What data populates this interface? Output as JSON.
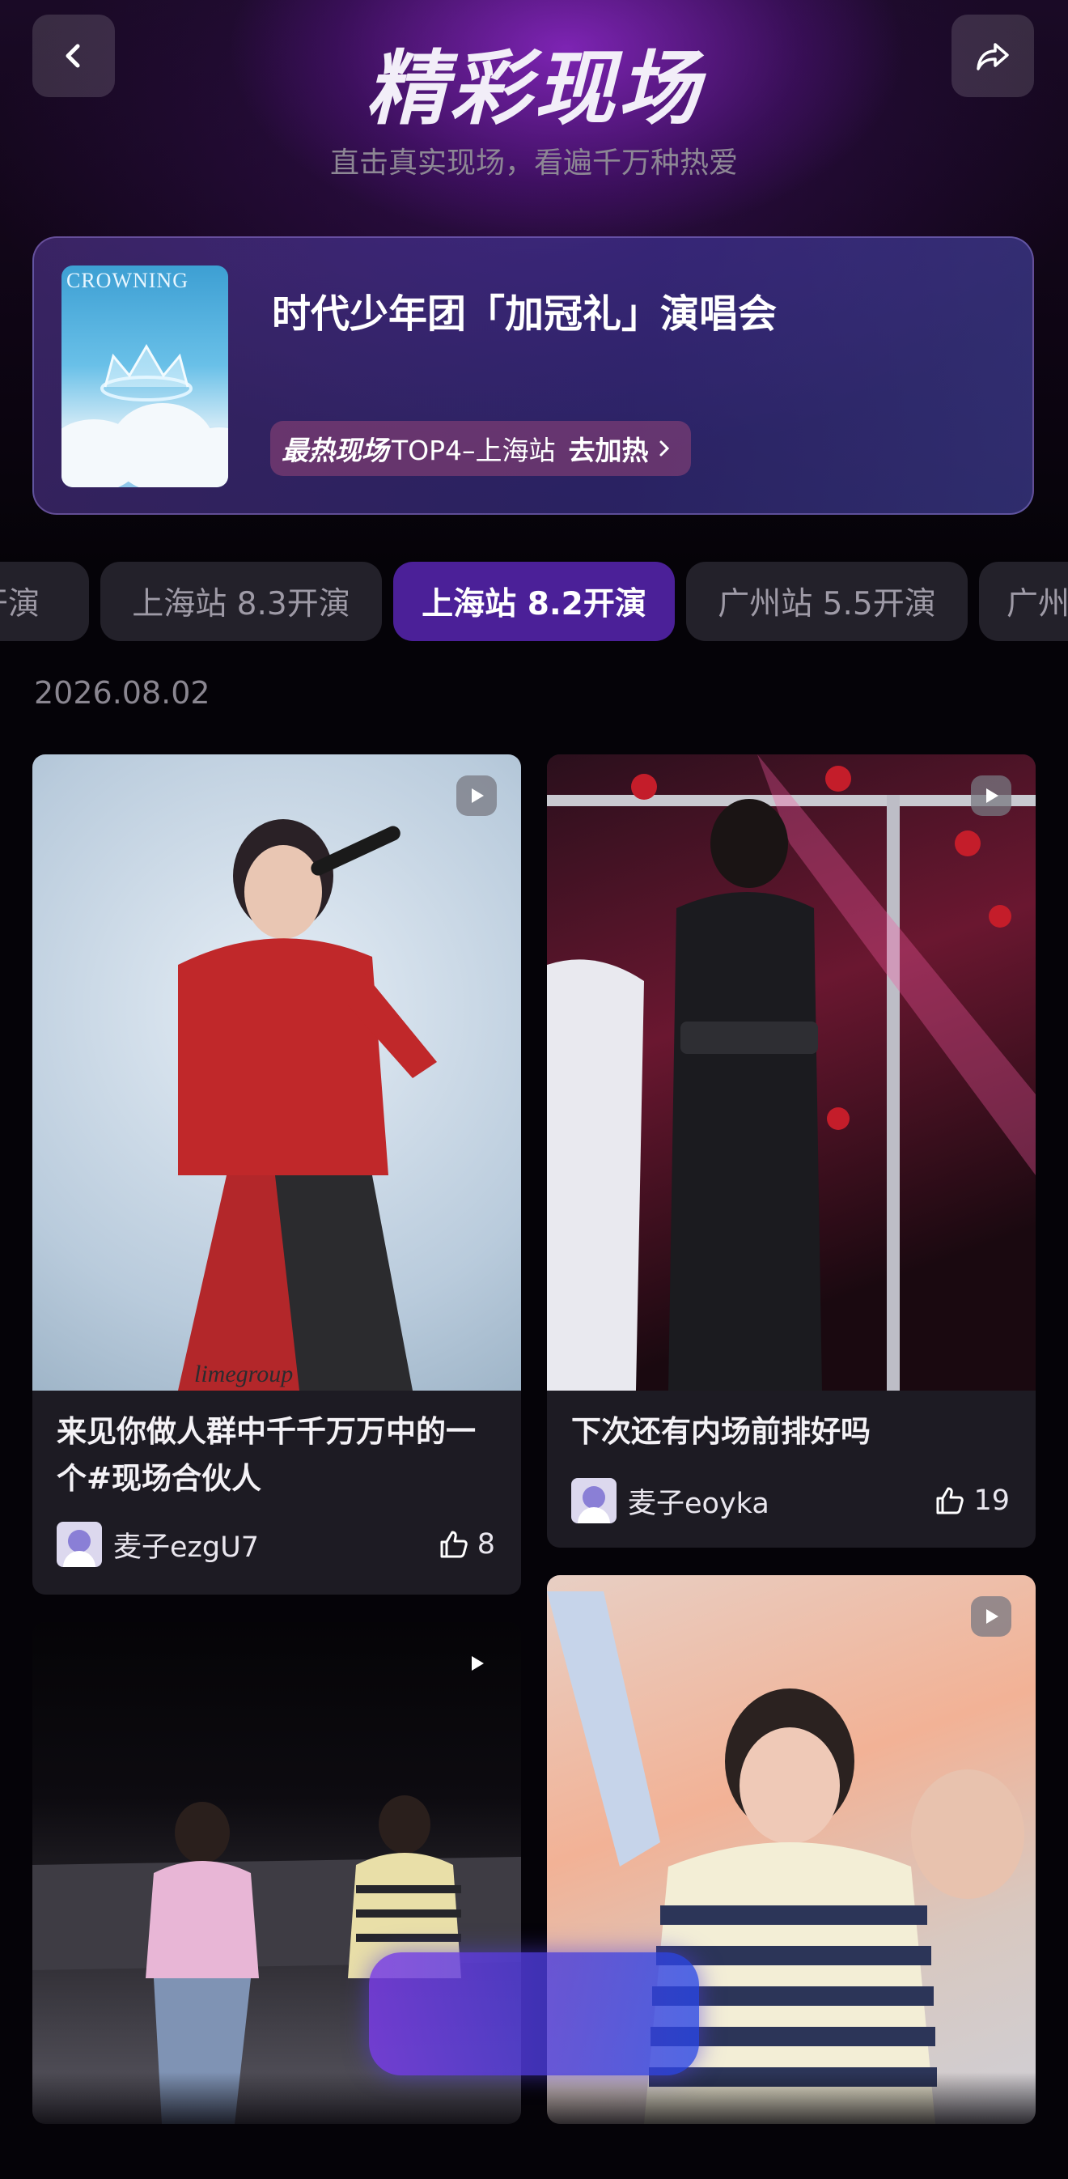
{
  "header": {
    "title": "精彩现场",
    "subtitle": "直击真实现场，看遍千万种热爱"
  },
  "concert": {
    "title": "时代少年团「加冠礼」演唱会",
    "poster_text": "CROWNING",
    "hot_label": "最热现场",
    "hot_rank": "TOP4–上海站",
    "hot_action": "去加热"
  },
  "tabs": [
    {
      "label": "开演",
      "active": false
    },
    {
      "label": "上海站 8.3开演",
      "active": false
    },
    {
      "label": "上海站 8.2开演",
      "active": true
    },
    {
      "label": "广州站 5.5开演",
      "active": false
    },
    {
      "label": "广州",
      "active": false
    }
  ],
  "date": "2026.08.02",
  "posts": [
    {
      "text_line1": "来见你做人群中千千万万中的一",
      "text_line2": "个#现场合伙人",
      "user": "麦子ezgU7",
      "likes": "8",
      "watermark": "limegroup"
    },
    {
      "text_line1": "下次还有内场前排好吗",
      "user": "麦子eoyka",
      "likes": "19"
    },
    {},
    {}
  ],
  "icons": {
    "back": "chevron-left-icon",
    "share": "share-icon",
    "play": "play-icon",
    "like": "thumbs-up-icon"
  },
  "colors": {
    "accent": "#4b2098",
    "background": "#050308"
  }
}
